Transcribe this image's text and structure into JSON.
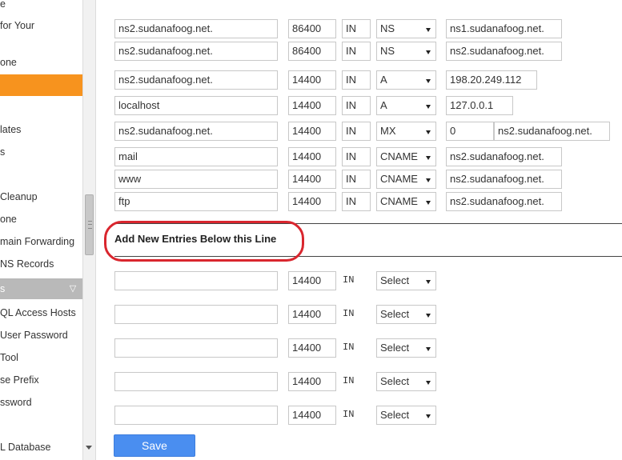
{
  "sidebar": {
    "items": [
      {
        "label": "e"
      },
      {
        "label": " for Your"
      },
      {
        "label": "one"
      },
      {
        "label": ""
      },
      {
        "label": "lates"
      },
      {
        "label": "s"
      },
      {
        "label": " Cleanup"
      },
      {
        "label": "one"
      },
      {
        "label": "main Forwarding"
      },
      {
        "label": "NS Records"
      },
      {
        "label": "s"
      },
      {
        "label": "QL Access Hosts"
      },
      {
        "label": " User Password"
      },
      {
        "label": "Tool"
      },
      {
        "label": "se Prefix"
      },
      {
        "label": "ssword"
      },
      {
        "label": "L Database"
      }
    ],
    "accent_color": "#f7931e"
  },
  "records": [
    {
      "name": "ns2.sudanafoog.net.",
      "ttl": "86400",
      "class": "IN",
      "type": "NS",
      "value": "ns1.sudanafoog.net."
    },
    {
      "name": "ns2.sudanafoog.net.",
      "ttl": "86400",
      "class": "IN",
      "type": "NS",
      "value": "ns2.sudanafoog.net."
    },
    {
      "name": "ns2.sudanafoog.net.",
      "ttl": "14400",
      "class": "IN",
      "type": "A",
      "value": "198.20.249.112"
    },
    {
      "name": "localhost",
      "ttl": "14400",
      "class": "IN",
      "type": "A",
      "value": "127.0.0.1"
    },
    {
      "name": "ns2.sudanafoog.net.",
      "ttl": "14400",
      "class": "IN",
      "type": "MX",
      "priority": "0",
      "value": "ns2.sudanafoog.net."
    },
    {
      "name": "mail",
      "ttl": "14400",
      "class": "IN",
      "type": "CNAME",
      "value": "ns2.sudanafoog.net."
    },
    {
      "name": "www",
      "ttl": "14400",
      "class": "IN",
      "type": "CNAME",
      "value": "ns2.sudanafoog.net."
    },
    {
      "name": "ftp",
      "ttl": "14400",
      "class": "IN",
      "type": "CNAME",
      "value": "ns2.sudanafoog.net."
    }
  ],
  "new_section": {
    "heading": "Add New Entries Below this Line",
    "highlight_color": "#d9262e"
  },
  "new_entries": [
    {
      "name": "",
      "ttl": "14400",
      "class": "IN",
      "type": "Select"
    },
    {
      "name": "",
      "ttl": "14400",
      "class": "IN",
      "type": "Select"
    },
    {
      "name": "",
      "ttl": "14400",
      "class": "IN",
      "type": "Select"
    },
    {
      "name": "",
      "ttl": "14400",
      "class": "IN",
      "type": "Select"
    },
    {
      "name": "",
      "ttl": "14400",
      "class": "IN",
      "type": "Select"
    }
  ],
  "save_label": "Save",
  "save_color": "#4a8ef0"
}
